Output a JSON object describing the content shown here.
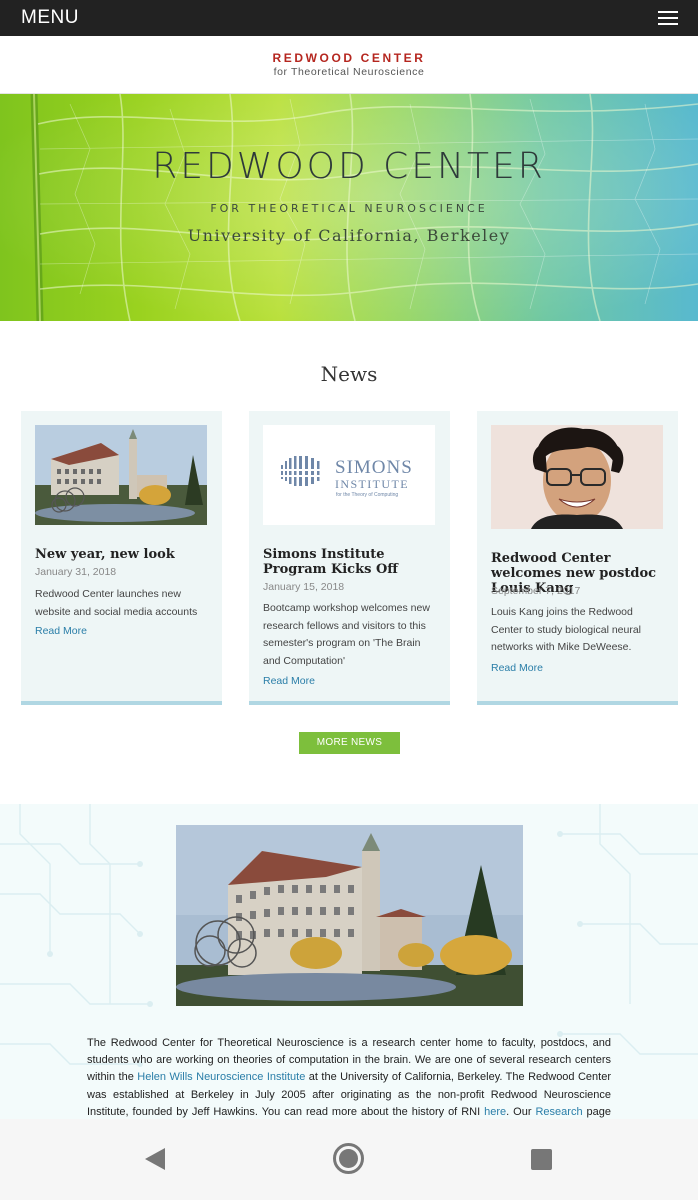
{
  "topbar": {
    "menu_label": "MENU",
    "menu_icon": "hamburger-icon"
  },
  "logo": {
    "title": "REDWOOD CENTER",
    "subtitle": "for Theoretical Neuroscience"
  },
  "hero": {
    "title": "REDWOOD CENTER",
    "subtitle": "FOR THEORETICAL NEUROSCIENCE",
    "university": "University of California, Berkeley"
  },
  "news": {
    "heading": "News",
    "cards": [
      {
        "title": "New year, new look",
        "date": "January 31, 2018",
        "body": "Redwood Center launches new website and social media accounts",
        "link": "Read More"
      },
      {
        "title": "Simons Institute Program Kicks Off",
        "date": "January 15, 2018",
        "body": "Bootcamp workshop welcomes new research fellows and visitors to this semester's program on 'The Brain and Computation'",
        "link": "Read More",
        "logo_line1": "SIMONS",
        "logo_line2": "INSTITUTE",
        "logo_line3": "for the Theory of Computing"
      },
      {
        "title": "Redwood Center welcomes new postdoc Louis Kang",
        "date": "September 7, 2017",
        "body": "Louis Kang joins the Redwood Center to study biological neural networks with Mike DeWeese.",
        "link": "Read More"
      }
    ],
    "more_button": "MORE NEWS"
  },
  "about": {
    "text_1": "The Redwood Center for Theoretical Neuroscience is a research center home to faculty, postdocs, and students who are working on theories of computation in the brain. We are one of several research centers within the ",
    "link_hwni": "Helen Wills Neuroscience Institute",
    "text_2": " at the University of California, Berkeley. The Redwood Center was established at Berkeley in July 2005 after originating as the non-profit Redwood Neuroscience Institute, founded by Jeff Hawkins. You can read more about the history of RNI ",
    "link_here": "here",
    "text_3": ". Our ",
    "link_research": "Research",
    "text_4": " page describes some of the things we"
  },
  "colors": {
    "topbar": "#222222",
    "logo_red": "#b5261f",
    "link_blue": "#2a7ea8",
    "button_green": "#7dbf3c",
    "card_bg": "#eef6f6",
    "card_border": "#b0d7e3"
  },
  "android_nav": {
    "back_icon": "back-triangle-icon",
    "home_icon": "home-circle-icon",
    "recent_icon": "recent-square-icon"
  }
}
